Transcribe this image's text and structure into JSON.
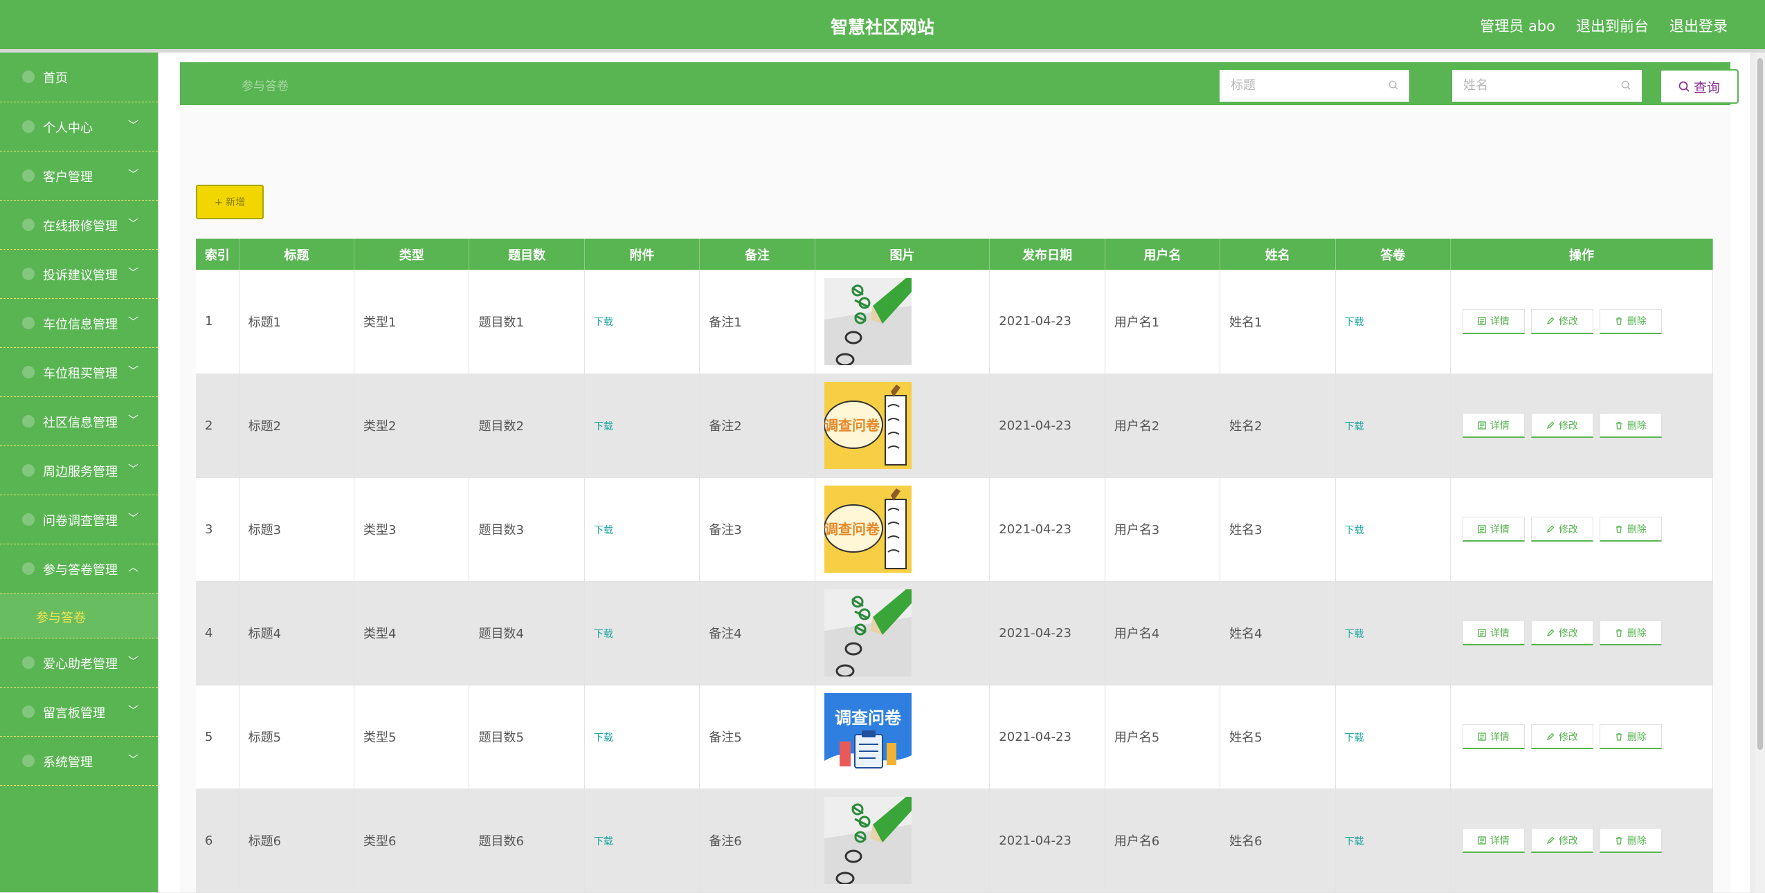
{
  "header": {
    "title": "智慧社区网站",
    "links": [
      "管理员 abo",
      "退出到前台",
      "退出登录"
    ]
  },
  "sidebar": {
    "items": [
      {
        "label": "首页",
        "icon": "home-icon"
      },
      {
        "label": "个人中心",
        "icon": "user-icon"
      },
      {
        "label": "客户管理",
        "icon": "user-icon"
      },
      {
        "label": "在线报修管理",
        "icon": "menu-icon"
      },
      {
        "label": "投诉建议管理",
        "icon": "menu-icon"
      },
      {
        "label": "车位信息管理",
        "icon": "menu-icon"
      },
      {
        "label": "车位租买管理",
        "icon": "menu-icon"
      },
      {
        "label": "社区信息管理",
        "icon": "menu-icon"
      },
      {
        "label": "周边服务管理",
        "icon": "menu-icon"
      },
      {
        "label": "问卷调查管理",
        "icon": "menu-icon"
      },
      {
        "label": "参与答卷管理",
        "icon": "menu-icon",
        "expanded": true
      },
      {
        "label": "爱心助老管理",
        "icon": "menu-icon"
      },
      {
        "label": "留言板管理",
        "icon": "menu-icon"
      },
      {
        "label": "系统管理",
        "icon": "gear-icon"
      }
    ],
    "subitem": "参与答卷"
  },
  "breadcrumb": "参与答卷",
  "search": {
    "title_label": "标题",
    "title_placeholder": "标题",
    "name_label": "姓名",
    "name_placeholder": "姓名",
    "query_label": "查询"
  },
  "add_label": "+ 新增",
  "table": {
    "headers": [
      "索引",
      "标题",
      "类型",
      "题目数",
      "附件",
      "备注",
      "图片",
      "发布日期",
      "用户名",
      "姓名",
      "答卷",
      "操作"
    ],
    "rows": [
      {
        "index": "1",
        "title": "标题1",
        "type": "类型1",
        "count": "题目数1",
        "attachment": "下载",
        "note": "备注1",
        "image": "checklist",
        "date": "2021-04-23",
        "username": "用户名1",
        "name": "姓名1",
        "answer": "下载"
      },
      {
        "index": "2",
        "title": "标题2",
        "type": "类型2",
        "count": "题目数2",
        "attachment": "下载",
        "note": "备注2",
        "image": "survey-yellow",
        "date": "2021-04-23",
        "username": "用户名2",
        "name": "姓名2",
        "answer": "下载"
      },
      {
        "index": "3",
        "title": "标题3",
        "type": "类型3",
        "count": "题目数3",
        "attachment": "下载",
        "note": "备注3",
        "image": "survey-yellow",
        "date": "2021-04-23",
        "username": "用户名3",
        "name": "姓名3",
        "answer": "下载"
      },
      {
        "index": "4",
        "title": "标题4",
        "type": "类型4",
        "count": "题目数4",
        "attachment": "下载",
        "note": "备注4",
        "image": "checklist",
        "date": "2021-04-23",
        "username": "用户名4",
        "name": "姓名4",
        "answer": "下载"
      },
      {
        "index": "5",
        "title": "标题5",
        "type": "类型5",
        "count": "题目数5",
        "attachment": "下载",
        "note": "备注5",
        "image": "survey-blue",
        "date": "2021-04-23",
        "username": "用户名5",
        "name": "姓名5",
        "answer": "下载"
      },
      {
        "index": "6",
        "title": "标题6",
        "type": "类型6",
        "count": "题目数6",
        "attachment": "下载",
        "note": "备注6",
        "image": "checklist",
        "date": "2021-04-23",
        "username": "用户名6",
        "name": "姓名6",
        "answer": "下载"
      }
    ],
    "actions": [
      "详情",
      "修改",
      "删除"
    ]
  },
  "image_texts": {
    "survey_yellow": "调查问卷",
    "survey_blue": "调查问卷"
  },
  "colors": {
    "brand_green": "#59b552",
    "highlight_yellow": "#f2d600",
    "link_teal": "#21a8a0"
  }
}
